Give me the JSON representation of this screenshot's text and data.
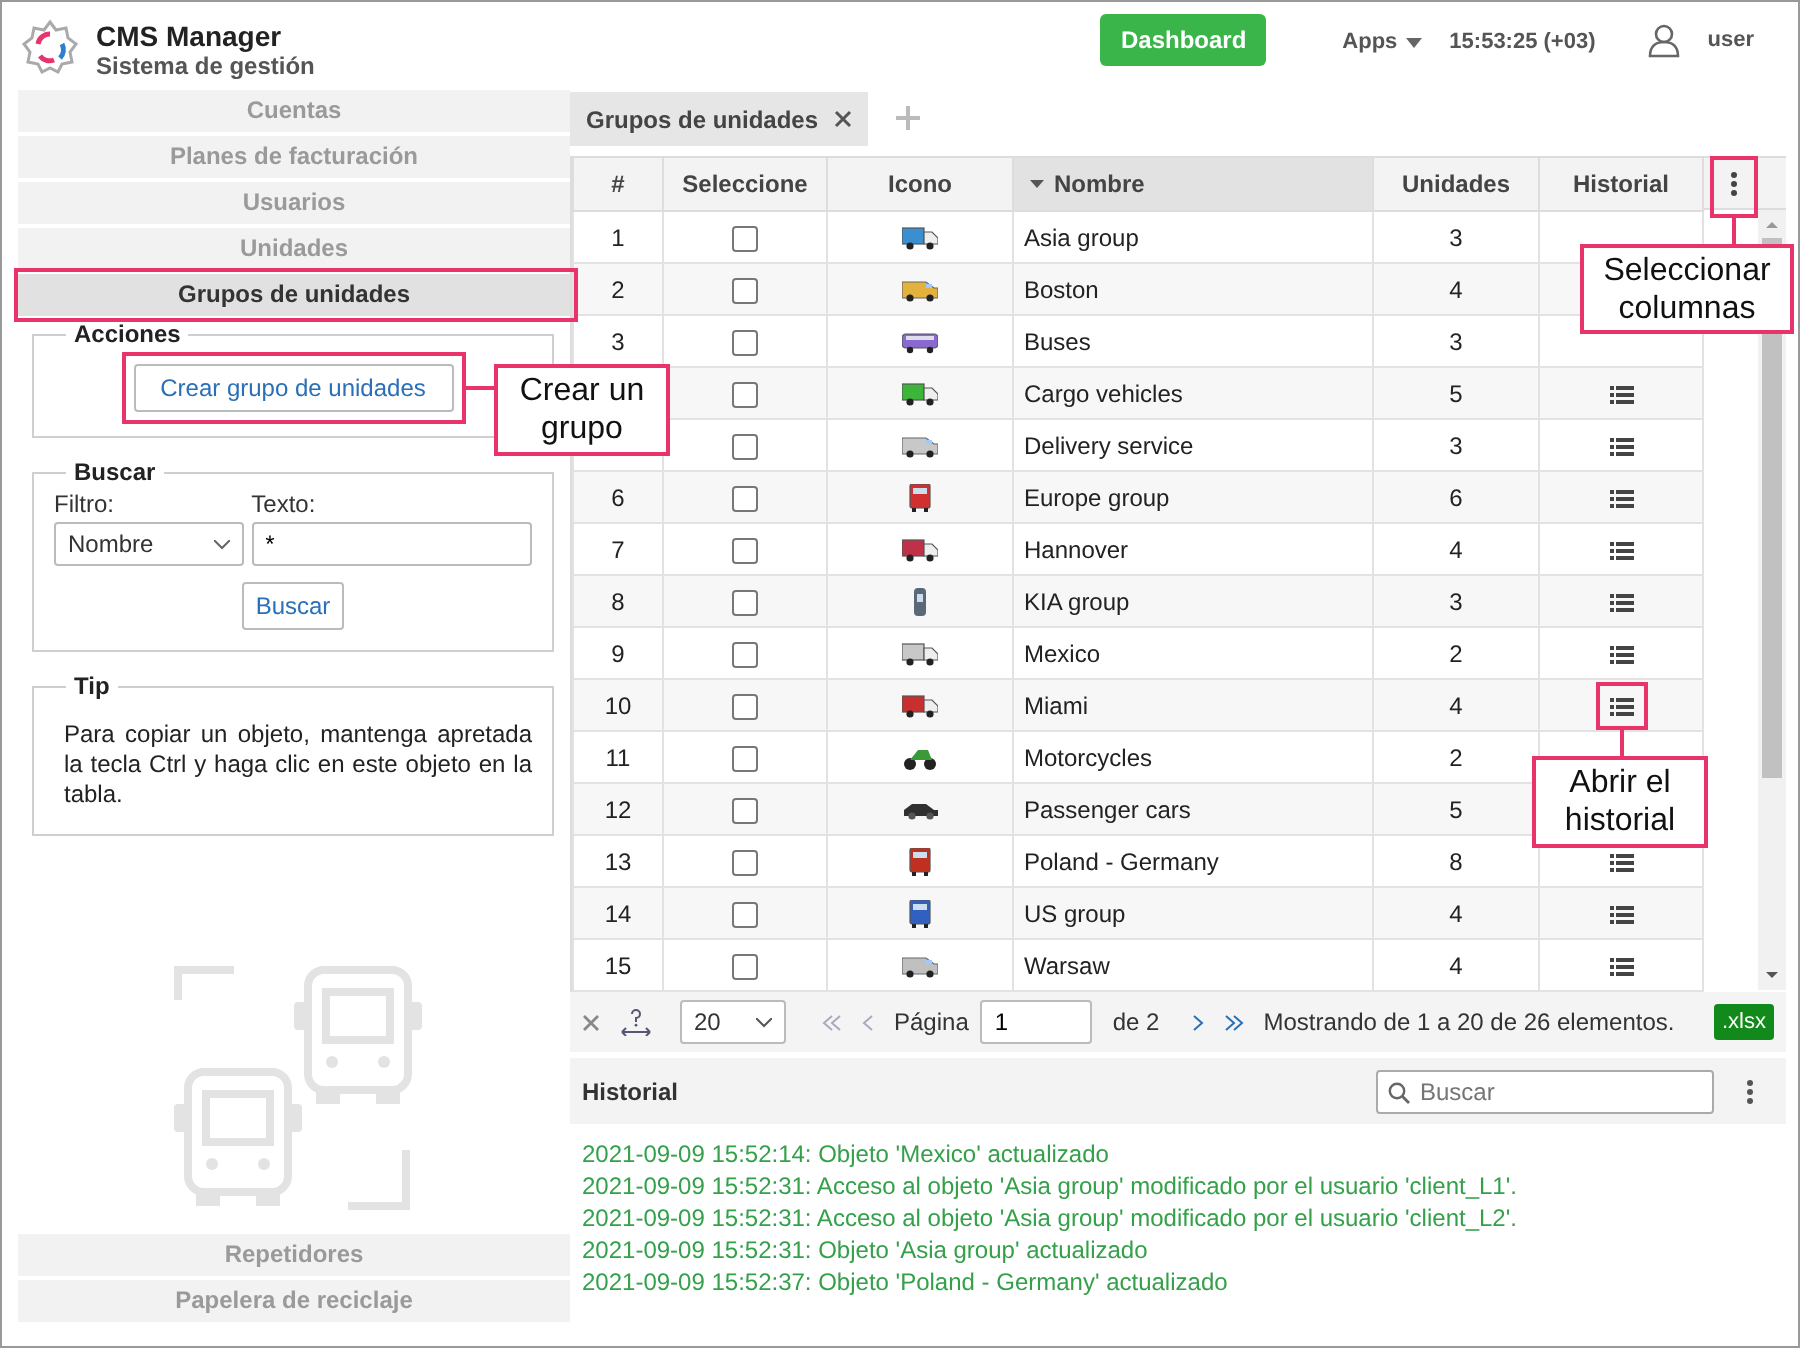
{
  "header": {
    "app_name": "CMS Manager",
    "subtitle": "Sistema de gestión",
    "dashboard_button": "Dashboard",
    "apps_menu": "Apps",
    "clock": "15:53:25 (+03)",
    "user": "user"
  },
  "sidebar": {
    "items": [
      {
        "label": "Cuentas",
        "selected": false
      },
      {
        "label": "Planes de facturación",
        "selected": false
      },
      {
        "label": "Usuarios",
        "selected": false
      },
      {
        "label": "Unidades",
        "selected": false
      },
      {
        "label": "Grupos de unidades",
        "selected": true
      }
    ],
    "bottom_items": [
      {
        "label": "Repetidores",
        "selected": false
      },
      {
        "label": "Papelera de reciclaje",
        "selected": false
      }
    ]
  },
  "actions_panel": {
    "title": "Acciones",
    "button": "Crear grupo de unidades"
  },
  "search_panel": {
    "title": "Buscar",
    "filter_label": "Filtro:",
    "filter_value": "Nombre",
    "text_label": "Texto:",
    "text_value": "*",
    "button": "Buscar"
  },
  "tip_panel": {
    "title": "Tip",
    "text": "Para copiar un objeto, mantenga apretada la tecla Ctrl y haga clic en este objeto en la tabla."
  },
  "tabs": [
    {
      "label": "Grupos de unidades",
      "selected": true
    }
  ],
  "table": {
    "columns": [
      {
        "label": "#",
        "sorted": false
      },
      {
        "label": "Seleccione",
        "sorted": false
      },
      {
        "label": "Icono",
        "sorted": false
      },
      {
        "label": "Nombre",
        "sorted": true
      },
      {
        "label": "Unidades",
        "sorted": false
      },
      {
        "label": "Historial",
        "sorted": false
      }
    ],
    "rows": [
      {
        "number": "1",
        "checked": false,
        "kind": "truck",
        "color": "#3a8fd0",
        "name": "Asia group",
        "units": "3"
      },
      {
        "number": "2",
        "checked": false,
        "kind": "van",
        "color": "#e3b23c",
        "name": "Boston",
        "units": "4"
      },
      {
        "number": "3",
        "checked": false,
        "kind": "bus",
        "color": "#8a6ad0",
        "name": "Buses",
        "units": "3"
      },
      {
        "checked": false,
        "kind": "truck",
        "color": "#3bb63b",
        "name": "Cargo vehicles",
        "units": "5"
      },
      {
        "checked": false,
        "kind": "van",
        "color": "#c8c8c8",
        "name": "Delivery service",
        "units": "3"
      },
      {
        "number": "6",
        "checked": false,
        "kind": "front",
        "color": "#d03030",
        "name": "Europe group",
        "units": "6"
      },
      {
        "number": "7",
        "checked": false,
        "kind": "truck",
        "color": "#c03048",
        "name": "Hannover",
        "units": "4"
      },
      {
        "number": "8",
        "checked": false,
        "kind": "tracker",
        "color": "#5a6878",
        "name": "KIA group",
        "units": "3"
      },
      {
        "number": "9",
        "checked": false,
        "kind": "truck",
        "color": "#c8c8c8",
        "name": "Mexico",
        "units": "2"
      },
      {
        "number": "10",
        "checked": false,
        "kind": "truck",
        "color": "#c83030",
        "name": "Miami",
        "units": "4"
      },
      {
        "number": "11",
        "checked": false,
        "kind": "moto",
        "color": "#3a9a3a",
        "name": "Motorcycles",
        "units": "2"
      },
      {
        "number": "12",
        "checked": false,
        "kind": "car",
        "color": "#303030",
        "name": "Passenger cars",
        "units": "5"
      },
      {
        "number": "13",
        "checked": false,
        "kind": "front",
        "color": "#c03020",
        "name": "Poland - Germany",
        "units": "8"
      },
      {
        "number": "14",
        "checked": false,
        "kind": "front",
        "color": "#3060c0",
        "name": "US group",
        "units": "4"
      },
      {
        "number": "15",
        "checked": false,
        "kind": "van",
        "color": "#c0c0c0",
        "name": "Warsaw",
        "units": "4"
      }
    ]
  },
  "pager": {
    "page_size": "20",
    "page_label": "Página",
    "page": "1",
    "of": "de 2",
    "summary": "Mostrando de 1 a 20 de 26 elementos.",
    "export": ".xlsx"
  },
  "history": {
    "title": "Historial",
    "search_placeholder": "Buscar",
    "entries": [
      "2021-09-09 15:52:14: Objeto 'Mexico' actualizado",
      "2021-09-09 15:52:31: Acceso al objeto 'Asia group' modificado por el usuario 'client_L1'.",
      "2021-09-09 15:52:31: Acceso al objeto 'Asia group' modificado por el usuario 'client_L2'.",
      "2021-09-09 15:52:31: Objeto 'Asia group' actualizado",
      "2021-09-09 15:52:37: Objeto 'Poland - Germany' actualizado"
    ]
  },
  "callouts": [
    {
      "text": "Crear un grupo"
    },
    {
      "text": "Seleccionar columnas"
    },
    {
      "text": "Abrir el historial"
    }
  ]
}
